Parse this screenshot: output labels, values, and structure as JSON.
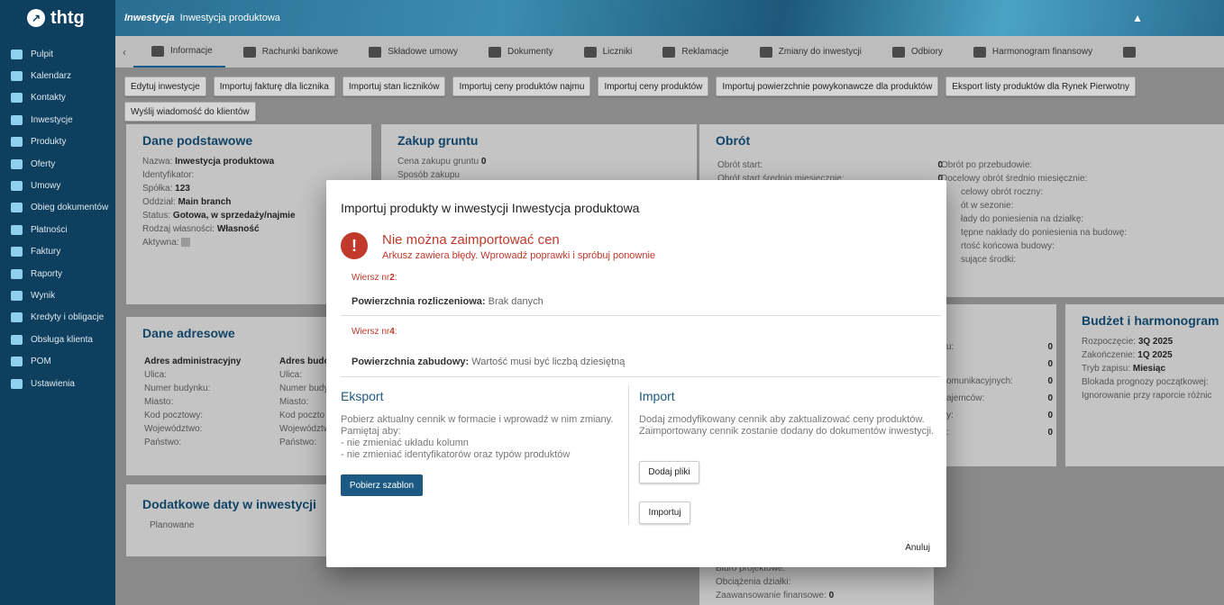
{
  "brand": "thtg",
  "sidebar": {
    "items": [
      {
        "label": "Pulpit",
        "icon": "dashboard-icon"
      },
      {
        "label": "Kalendarz",
        "icon": "calendar-icon"
      },
      {
        "label": "Kontakty",
        "icon": "contacts-icon"
      },
      {
        "label": "Inwestycje",
        "icon": "investments-icon"
      },
      {
        "label": "Produkty",
        "icon": "products-icon"
      },
      {
        "label": "Oferty",
        "icon": "offers-icon"
      },
      {
        "label": "Umowy",
        "icon": "contracts-icon"
      },
      {
        "label": "Obieg dokumentów",
        "icon": "documents-icon"
      },
      {
        "label": "Płatności",
        "icon": "payments-icon"
      },
      {
        "label": "Faktury",
        "icon": "invoices-icon"
      },
      {
        "label": "Raporty",
        "icon": "reports-icon"
      },
      {
        "label": "Wynik",
        "icon": "result-icon"
      },
      {
        "label": "Kredyty i obligacje",
        "icon": "credits-icon"
      },
      {
        "label": "Obsługa klienta",
        "icon": "support-icon"
      },
      {
        "label": "POM",
        "icon": "pom-icon"
      },
      {
        "label": "Ustawienia",
        "icon": "settings-icon"
      }
    ]
  },
  "header": {
    "crumb_section": "Inwestycja",
    "crumb_name": "Inwestycja produktowa"
  },
  "tabs": [
    {
      "label": "Informacje"
    },
    {
      "label": "Rachunki bankowe"
    },
    {
      "label": "Składowe umowy"
    },
    {
      "label": "Dokumenty"
    },
    {
      "label": "Liczniki"
    },
    {
      "label": "Reklamacje"
    },
    {
      "label": "Zmiany do inwestycji"
    },
    {
      "label": "Odbiory"
    },
    {
      "label": "Harmonogram finansowy"
    }
  ],
  "toolbar": [
    "Edytuj inwestycje",
    "Importuj fakturę dla licznika",
    "Importuj stan liczników",
    "Importuj ceny produktów najmu",
    "Importuj ceny produktów",
    "Importuj powierzchnie powykonawcze dla produktów",
    "Eksport listy produktów dla Rynek Pierwotny",
    "Wyślij wiadomość do klientów"
  ],
  "cards": {
    "basic": {
      "title": "Dane podstawowe",
      "nazwa_label": "Nazwa:",
      "nazwa": "Inwestycja produktowa",
      "id_label": "Identyfikator:",
      "spolka_label": "Spółka:",
      "spolka": "123",
      "oddzial_label": "Oddział:",
      "oddzial": "Main branch",
      "status_label": "Status:",
      "status": "Gotowa, w sprzedaży/najmie",
      "rodzaj_label": "Rodzaj własności:",
      "rodzaj": "Własność",
      "aktywna_label": "Aktywna:"
    },
    "land": {
      "title": "Zakup gruntu",
      "cena_label": "Cena zakupu gruntu",
      "cena": "0",
      "sposob_label": "Sposób zakupu"
    },
    "turnover": {
      "title": "Obrót",
      "start_label": "Obrót start:",
      "start": "0",
      "start_avg_label": "Obrót start średnio miesięcznie:",
      "start_avg": "0",
      "r1": "Obrót po przebudowie:",
      "r2": "Docelowy obrót średnio miesięcznie:",
      "r3": "celowy obrót roczny:",
      "r4": "ót w sezonie:",
      "r5": "łady do poniesienia na działkę:",
      "r6": "tępne nakłady do poniesienia na budowę:",
      "r7": "rtość końcowa budowy:",
      "r8": "sujące środki:"
    },
    "address": {
      "title": "Dane adresowe",
      "admin_header": "Adres administracyjny",
      "build_header": "Adres budowy",
      "ulica": "Ulica:",
      "numer": "Numer budynku:",
      "numer_short": "Numer budy",
      "miasto": "Miasto:",
      "kod": "Kod pocztowy:",
      "kod_short": "Kod poczto",
      "woj": "Województwo:",
      "woj_short": "Województw",
      "panstwo": "Państwo:"
    },
    "mid": {
      "r1": "u:",
      "v1": "0",
      "r2": "",
      "v2": "0",
      "r3": "omunikacyjnych:",
      "v3": "0",
      "r4": "ajemców:",
      "v4": "0",
      "r5": "y:",
      "v5": "0",
      "r6": ":",
      "v6": "0"
    },
    "budget": {
      "title": "Budżet i harmonogram",
      "start_label": "Rozpoczęcie:",
      "start": "3Q 2025",
      "end_label": "Zakończenie:",
      "end": "1Q 2025",
      "tryb_label": "Tryb zapisu:",
      "tryb": "Miesiąc",
      "r4": "Blokada prognozy początkowej:",
      "r5": "Ignorowanie przy raporcie różnic"
    },
    "dates": {
      "title": "Dodatkowe daty w inwestycji",
      "planowane": "Planowane"
    },
    "bottom": {
      "r1": "Biuro projektowe:",
      "r2": "Obciążenia działki:",
      "r3_label": "Zaawansowanie finansowe:",
      "r3": "0"
    }
  },
  "modal": {
    "title": "Importuj produkty w inwestycji Inwestycja produktowa",
    "error_heading": "Nie można zaimportować cen",
    "error_sub": "Arkusz zawiera błędy. Wprowadź poprawki i spróbuj ponownie",
    "rows": [
      {
        "prefix": "Wiersz nr",
        "num": "2",
        "suffix": ":",
        "field": "Powierzchnia rozliczeniowa:",
        "msg": "Brak danych"
      },
      {
        "prefix": "Wiersz nr",
        "num": "4",
        "suffix": ":",
        "field": "Powierzchnia zabudowy:",
        "msg": "Wartość musi być liczbą dziesiętną"
      }
    ],
    "export": {
      "title": "Eksport",
      "text": "Pobierz aktualny cennik w formacie i wprowadź w nim zmiany.\nPamiętaj aby:\n- nie zmieniać układu kolumn\n- nie zmieniać identyfikatorów oraz typów produktów",
      "button": "Pobierz szablon"
    },
    "import": {
      "title": "Import",
      "text": "Dodaj zmodyfikowany cennik aby zaktualizować ceny produktów.\nZaimportowany cennik zostanie dodany do dokumentów inwestycji.",
      "add_button": "Dodaj pliki",
      "import_button": "Importuj"
    },
    "cancel": "Anuluj"
  }
}
